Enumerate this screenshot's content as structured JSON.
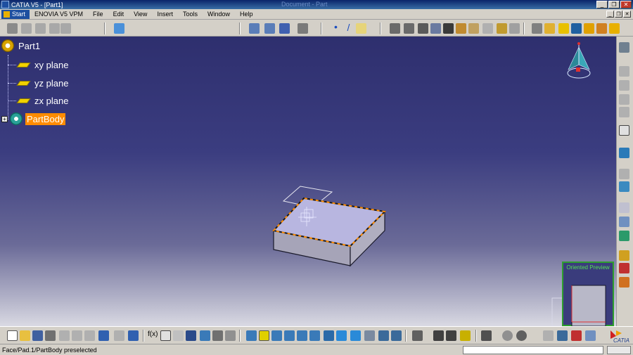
{
  "window": {
    "title": "CATIA V5 - [Part1]",
    "ghost_title": "Document - Part",
    "min": "_",
    "restore": "❐",
    "close": "✕"
  },
  "menu": {
    "start": "Start",
    "items": [
      "ENOVIA V5 VPM",
      "File",
      "Edit",
      "View",
      "Insert",
      "Tools",
      "Window",
      "Help"
    ]
  },
  "tree": {
    "root": "Part1",
    "items": [
      "xy plane",
      "yz plane",
      "zx plane"
    ],
    "body": "PartBody",
    "expander": "+"
  },
  "preview": {
    "title": "Oriented Preview"
  },
  "status": {
    "message": "Face/Pad.1/PartBody preselected"
  },
  "logo": "CATIA",
  "colors": {
    "titlebar": "#0a246a",
    "selection": "#ff8c00",
    "preview_border": "#2e9e2e"
  }
}
